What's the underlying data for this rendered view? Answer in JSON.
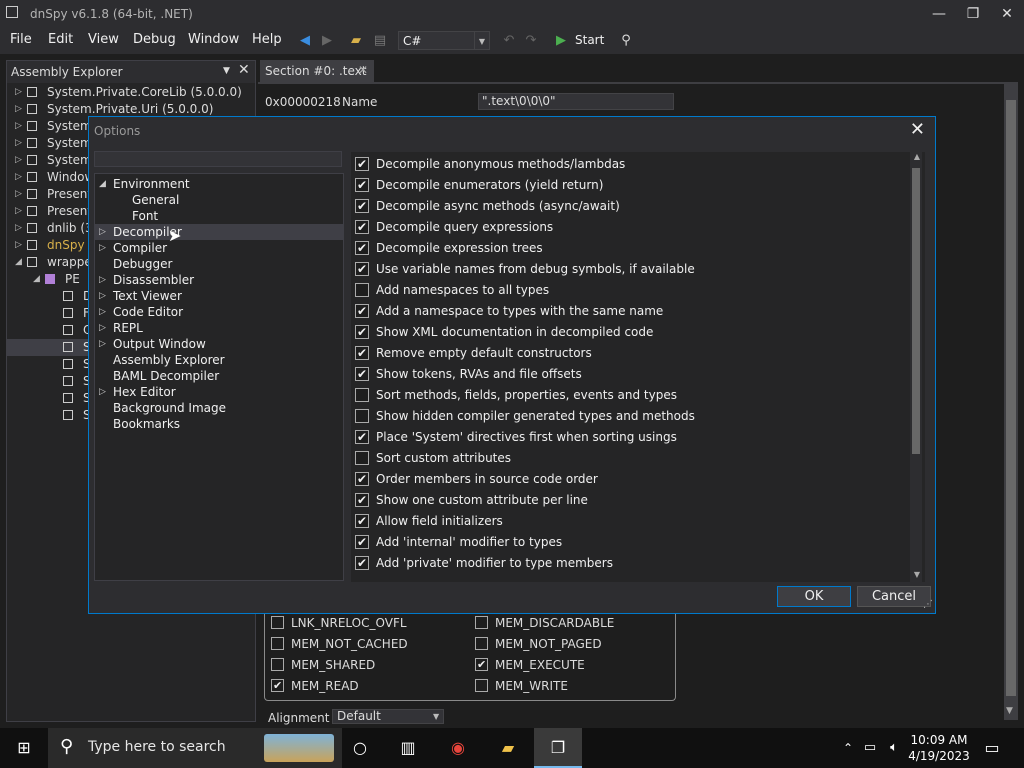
{
  "window": {
    "title": "dnSpy v6.1.8 (64-bit, .NET)",
    "controls": [
      "—",
      "❐",
      "✕"
    ]
  },
  "menu": [
    "File",
    "Edit",
    "View",
    "Debug",
    "Window",
    "Help"
  ],
  "toolbar": {
    "language": "C#",
    "start_label": "Start"
  },
  "assembly_explorer": {
    "title": "Assembly Explorer",
    "items": [
      {
        "label": "System.Private.CoreLib (5.0.0.0)",
        "indent": 0,
        "expand": "▷"
      },
      {
        "label": "System.Private.Uri (5.0.0.0)",
        "indent": 0,
        "expand": "▷"
      },
      {
        "label": "System.",
        "indent": 0,
        "expand": "▷"
      },
      {
        "label": "System.",
        "indent": 0,
        "expand": "▷"
      },
      {
        "label": "System.",
        "indent": 0,
        "expand": "▷"
      },
      {
        "label": "Window",
        "indent": 0,
        "expand": "▷"
      },
      {
        "label": "Presenta",
        "indent": 0,
        "expand": "▷"
      },
      {
        "label": "Presenta",
        "indent": 0,
        "expand": "▷"
      },
      {
        "label": "dnlib (3",
        "indent": 0,
        "expand": "▷"
      },
      {
        "label": "dnSpy (",
        "indent": 0,
        "expand": "▷"
      },
      {
        "label": "wrapper",
        "indent": 0,
        "expand": "◢"
      },
      {
        "label": "PE",
        "indent": 1,
        "expand": "◢"
      },
      {
        "label": "D",
        "indent": 2,
        "expand": ""
      },
      {
        "label": "F",
        "indent": 2,
        "expand": ""
      },
      {
        "label": "O",
        "indent": 2,
        "expand": ""
      },
      {
        "label": "S",
        "indent": 2,
        "expand": ""
      },
      {
        "label": "S",
        "indent": 2,
        "expand": ""
      },
      {
        "label": "S",
        "indent": 2,
        "expand": ""
      },
      {
        "label": "S",
        "indent": 2,
        "expand": ""
      },
      {
        "label": "S",
        "indent": 2,
        "expand": ""
      }
    ]
  },
  "document": {
    "tab_label": "Section #0: .text",
    "address": "0x00000218",
    "field_name": "Name",
    "field_value": "\".text\\0\\0\\0\"",
    "flags": [
      {
        "label": "LNK_NRELOC_OVFL",
        "checked": false
      },
      {
        "label": "MEM_DISCARDABLE",
        "checked": false
      },
      {
        "label": "MEM_NOT_CACHED",
        "checked": false
      },
      {
        "label": "MEM_NOT_PAGED",
        "checked": false
      },
      {
        "label": "MEM_SHARED",
        "checked": false
      },
      {
        "label": "MEM_EXECUTE",
        "checked": true
      },
      {
        "label": "MEM_READ",
        "checked": true
      },
      {
        "label": "MEM_WRITE",
        "checked": false
      }
    ],
    "alignment_label": "Alignment",
    "alignment_value": "Default"
  },
  "options_dialog": {
    "title": "Options",
    "tree": [
      {
        "label": "Environment",
        "indent": 0,
        "expand": "◢",
        "selected": false
      },
      {
        "label": "General",
        "indent": 1,
        "expand": "",
        "selected": false
      },
      {
        "label": "Font",
        "indent": 1,
        "expand": "",
        "selected": false
      },
      {
        "label": "Decompiler",
        "indent": 0,
        "expand": "▷",
        "selected": true
      },
      {
        "label": "Compiler",
        "indent": 0,
        "expand": "▷",
        "selected": false
      },
      {
        "label": "Debugger",
        "indent": 0,
        "expand": "",
        "selected": false
      },
      {
        "label": "Disassembler",
        "indent": 0,
        "expand": "▷",
        "selected": false
      },
      {
        "label": "Text Viewer",
        "indent": 0,
        "expand": "▷",
        "selected": false
      },
      {
        "label": "Code Editor",
        "indent": 0,
        "expand": "▷",
        "selected": false
      },
      {
        "label": "REPL",
        "indent": 0,
        "expand": "▷",
        "selected": false
      },
      {
        "label": "Output Window",
        "indent": 0,
        "expand": "▷",
        "selected": false
      },
      {
        "label": "Assembly Explorer",
        "indent": 0,
        "expand": "",
        "selected": false
      },
      {
        "label": "BAML Decompiler",
        "indent": 0,
        "expand": "",
        "selected": false
      },
      {
        "label": "Hex Editor",
        "indent": 0,
        "expand": "▷",
        "selected": false
      },
      {
        "label": "Background Image",
        "indent": 0,
        "expand": "",
        "selected": false
      },
      {
        "label": "Bookmarks",
        "indent": 0,
        "expand": "",
        "selected": false
      }
    ],
    "options": [
      {
        "label": "Decompile anonymous methods/lambdas",
        "checked": true
      },
      {
        "label": "Decompile enumerators (yield return)",
        "checked": true
      },
      {
        "label": "Decompile async methods (async/await)",
        "checked": true
      },
      {
        "label": "Decompile query expressions",
        "checked": true
      },
      {
        "label": "Decompile expression trees",
        "checked": true
      },
      {
        "label": "Use variable names from debug symbols, if available",
        "checked": true
      },
      {
        "label": "Add namespaces to all types",
        "checked": false
      },
      {
        "label": "Add a namespace to types with the same name",
        "checked": true
      },
      {
        "label": "Show XML documentation in decompiled code",
        "checked": true
      },
      {
        "label": "Remove empty default constructors",
        "checked": true
      },
      {
        "label": "Show tokens, RVAs and file offsets",
        "checked": true
      },
      {
        "label": "Sort methods, fields, properties, events and types",
        "checked": false
      },
      {
        "label": "Show hidden compiler generated types and methods",
        "checked": false
      },
      {
        "label": "Place 'System' directives first when sorting usings",
        "checked": true
      },
      {
        "label": "Sort custom attributes",
        "checked": false
      },
      {
        "label": "Order members in source code order",
        "checked": true
      },
      {
        "label": "Show one custom attribute per line",
        "checked": true
      },
      {
        "label": "Allow field initializers",
        "checked": true
      },
      {
        "label": "Add 'internal' modifier to types",
        "checked": true
      },
      {
        "label": "Add 'private' modifier to type members",
        "checked": true
      }
    ],
    "ok_label": "OK",
    "cancel_label": "Cancel"
  },
  "taskbar": {
    "search_placeholder": "Type here to search",
    "time": "10:09 AM",
    "date": "4/19/2023"
  },
  "colors": {
    "accent": "#007acc",
    "background": "#1e1e1e",
    "panel": "#252526",
    "chrome": "#2d2d30"
  }
}
